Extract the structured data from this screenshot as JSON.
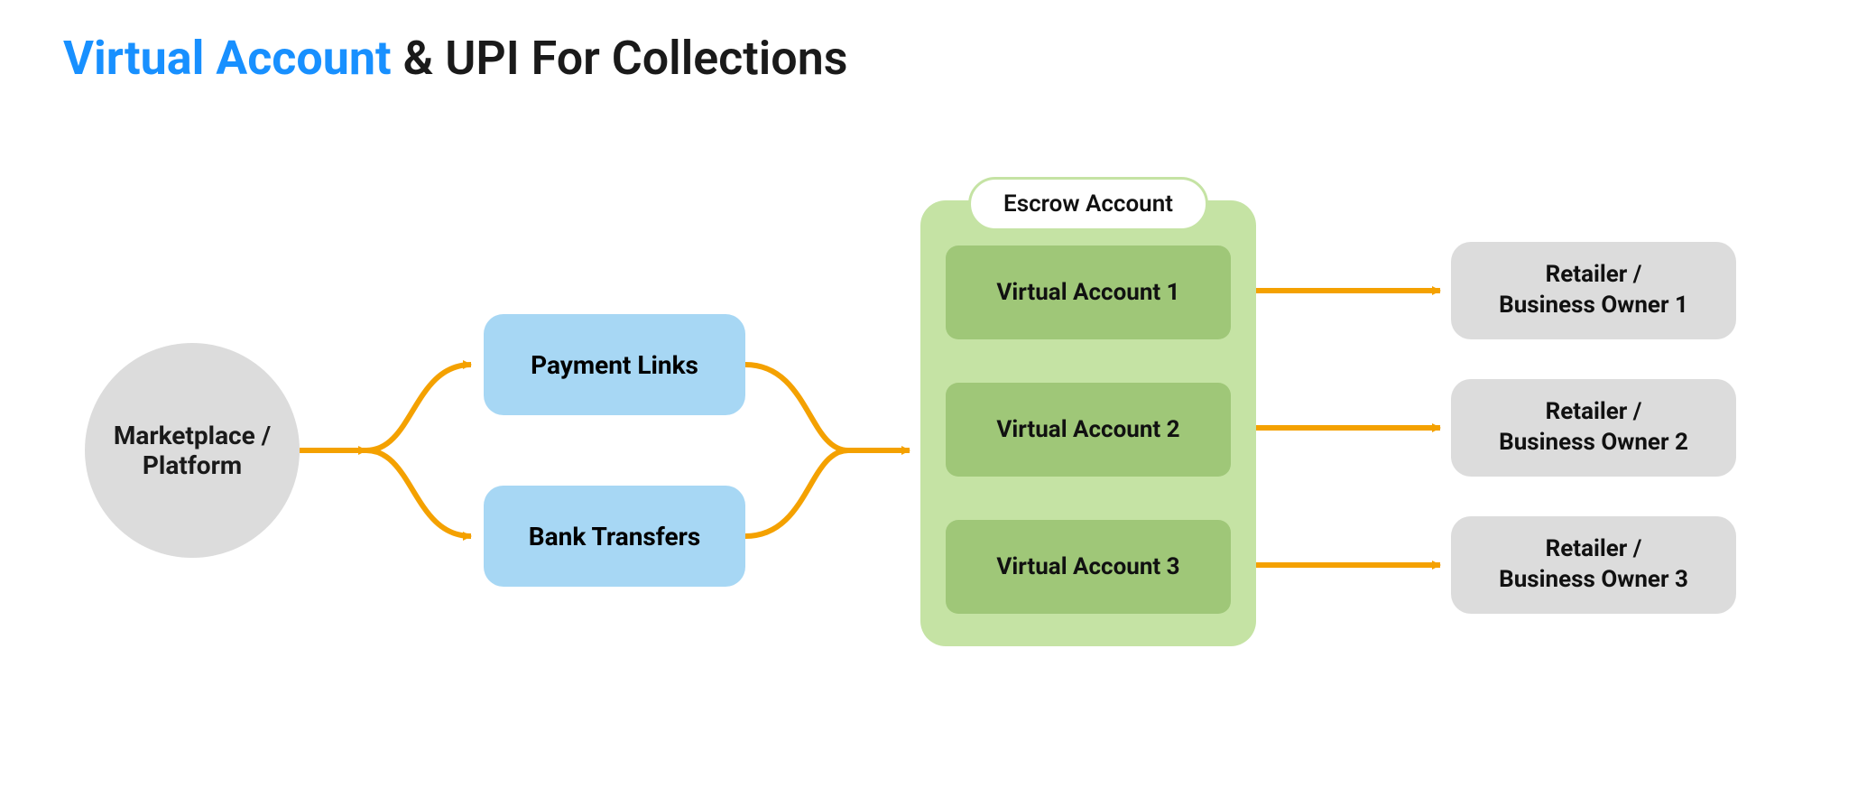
{
  "title": {
    "accent": "Virtual Account",
    "rest": " & UPI For Collections"
  },
  "source": {
    "line1": "Marketplace /",
    "line2": "Platform"
  },
  "paymentMethods": {
    "top": "Payment Links",
    "bottom": "Bank Transfers"
  },
  "escrow": {
    "label": "Escrow Account",
    "accounts": [
      "Virtual Account 1",
      "Virtual Account 2",
      "Virtual Account 3"
    ]
  },
  "retailers": [
    {
      "line1": "Retailer /",
      "line2": "Business Owner 1"
    },
    {
      "line1": "Retailer /",
      "line2": "Business Owner 2"
    },
    {
      "line1": "Retailer /",
      "line2": "Business Owner 3"
    }
  ],
  "colors": {
    "arrow": "#f4a100"
  }
}
